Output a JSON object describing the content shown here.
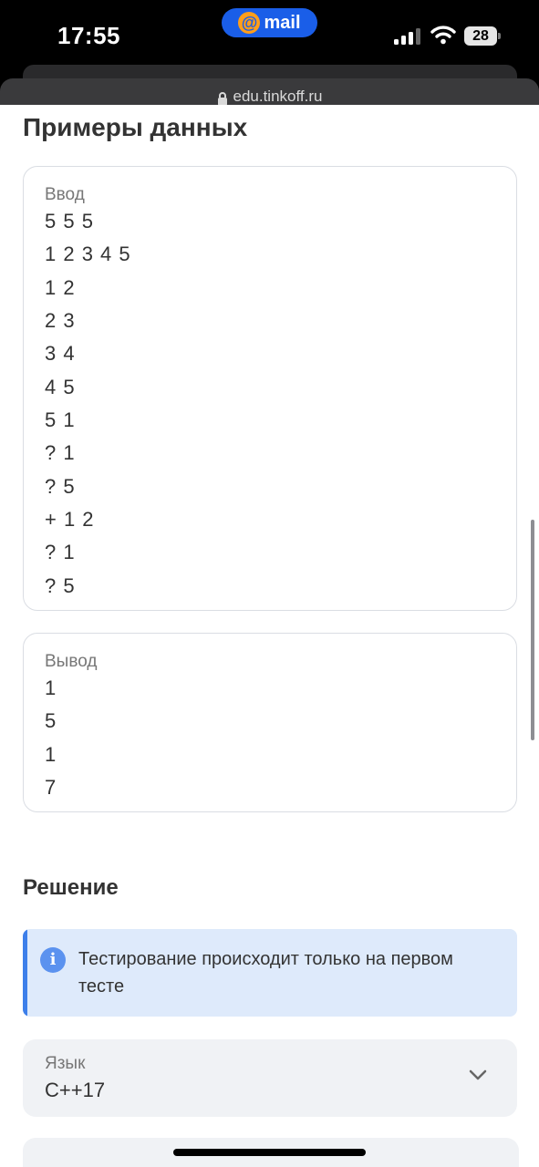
{
  "status_bar": {
    "time": "17:55",
    "island_app": "mail",
    "island_symbol": "@",
    "battery_level": "28"
  },
  "browser": {
    "url": "edu.tinkoff.ru"
  },
  "examples": {
    "title": "Примеры данных",
    "input": {
      "label": "Ввод",
      "lines": [
        "5 5 5",
        "1 2 3 4 5",
        "1 2",
        "2 3",
        "3 4",
        "4 5",
        "5 1",
        "? 1",
        "? 5",
        "+ 1 2",
        "? 1",
        "? 5"
      ]
    },
    "output": {
      "label": "Вывод",
      "lines": [
        "1",
        "5",
        "1",
        "7"
      ]
    }
  },
  "solution": {
    "title": "Решение",
    "info": "Тестирование происходит только на первом тесте",
    "info_icon": "info-icon",
    "language": {
      "label": "Язык",
      "value": "C++17"
    }
  },
  "colors": {
    "accent": "#3d7fea",
    "info_bg": "#deeafb",
    "select_bg": "#f0f2f5",
    "mail_blue": "#1a5ee8"
  }
}
